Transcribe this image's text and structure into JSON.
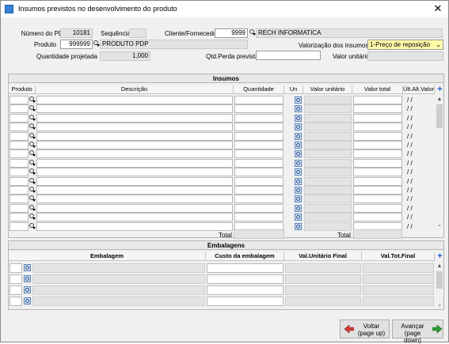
{
  "window": {
    "title": "Insumos previstos no desenvolvimento do produto",
    "close_glyph": "✕"
  },
  "header": {
    "numero_pdp_label": "Número do PDP",
    "numero_pdp_value": "10181",
    "sequencia_label": "Sequência",
    "sequencia_value": "",
    "cliente_label": "Cliente/Fornecedor",
    "cliente_code": "9999",
    "cliente_name": "RECH INFORMATICA",
    "produto_label": "Produto",
    "produto_code": "999999",
    "produto_name": "PRODUTO PDP",
    "valorizacao_label": "Valorização dos insumos",
    "valorizacao_value": "1-Preço de reposição",
    "quantidade_label": "Quantidade projetada",
    "quantidade_value": "1,000",
    "perda_label": "Qtd.Perda prevista",
    "perda_value": "",
    "valor_unitario_label": "Valor unitário",
    "valor_unitario_value": ""
  },
  "insumos": {
    "title": "Insumos",
    "columns": [
      "Produto",
      "Descrição",
      "Quantidade",
      "Un",
      "Valor unitário",
      "Valor total",
      "Últ.Alt.Valor"
    ],
    "date_placeholder": "/ /",
    "rows": 15,
    "total_label": "Total",
    "total_label2": "Total",
    "total_quantidade": "",
    "total_valor": ""
  },
  "embalagens": {
    "title": "Embalagens",
    "columns": [
      "Embalagem",
      "Custo da embalagem",
      "Val.Unitário Final",
      "Val.Tot.Final"
    ],
    "rows": 4
  },
  "footer": {
    "voltar_line1": "Voltar",
    "voltar_line2": "(page up)",
    "avancar_line1": "Avançar",
    "avancar_line2": "(page down)"
  },
  "colors": {
    "accent": "#1f5fcf",
    "select_bg": "#fffba8",
    "voltar_icon": "#d33a3a",
    "avancar_icon": "#2e9e3a"
  }
}
